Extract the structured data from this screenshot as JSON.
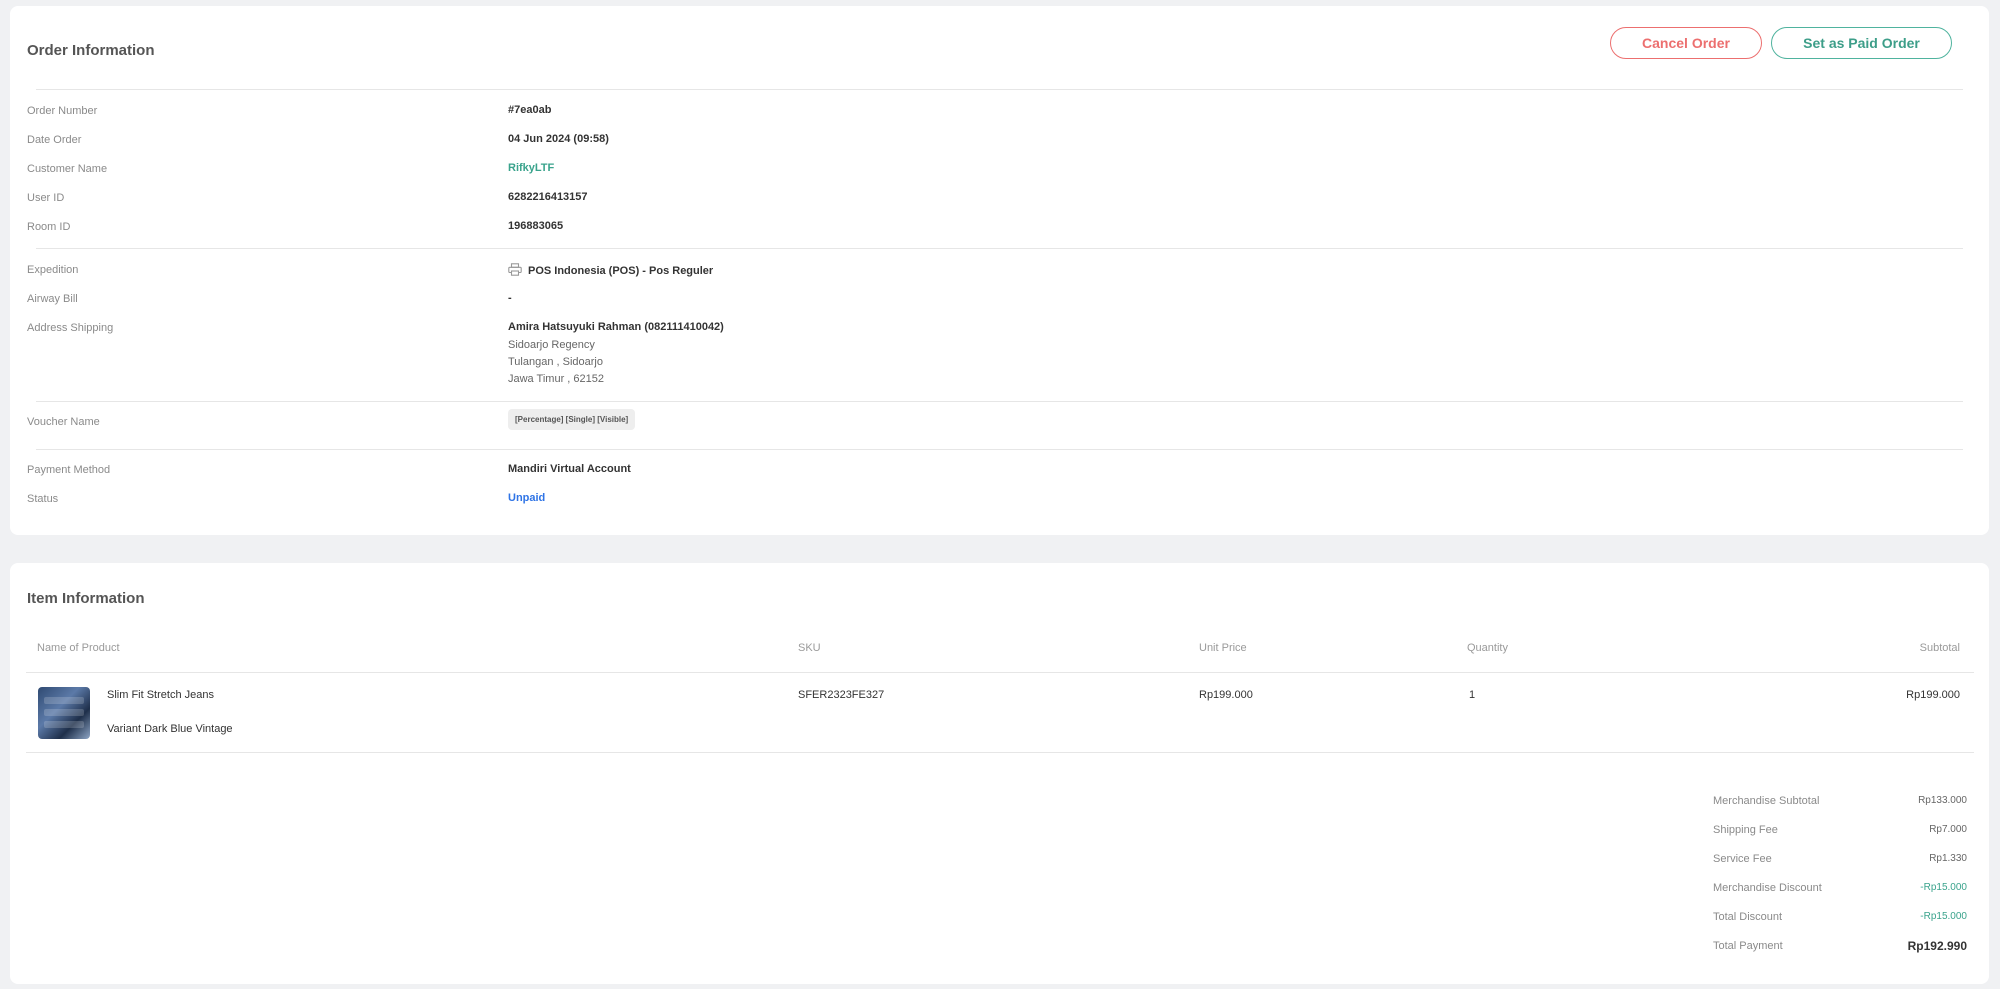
{
  "order_info": {
    "title": "Order Information",
    "cancel_label": "Cancel Order",
    "paid_label": "Set as Paid Order",
    "fields": {
      "order_number": {
        "label": "Order Number",
        "value": "#7ea0ab"
      },
      "date_order": {
        "label": "Date Order",
        "value": "04 Jun 2024 (09:58)"
      },
      "customer_name": {
        "label": "Customer Name",
        "value": "RifkyLTF"
      },
      "user_id": {
        "label": "User ID",
        "value": "6282216413157"
      },
      "room_id": {
        "label": "Room ID",
        "value": "196883065"
      },
      "expedition": {
        "label": "Expedition",
        "value": "POS Indonesia (POS) - Pos Reguler",
        "icon": "printer-icon"
      },
      "airway_bill": {
        "label": "Airway Bill",
        "value": "-"
      },
      "address_shipping": {
        "label": "Address Shipping",
        "name_line": "Amira Hatsuyuki Rahman (082111410042)",
        "line2": "Sidoarjo Regency",
        "line3": "Tulangan , Sidoarjo",
        "line4": "Jawa Timur , 62152"
      },
      "voucher_name": {
        "label": "Voucher Name",
        "chip": "[Percentage] [Single] [Visible]"
      },
      "payment_method": {
        "label": "Payment Method",
        "value": "Mandiri Virtual Account"
      },
      "status": {
        "label": "Status",
        "value": "Unpaid"
      }
    }
  },
  "item_info": {
    "title": "Item Information",
    "columns": {
      "product": "Name of Product",
      "sku": "SKU",
      "unit_price": "Unit Price",
      "quantity": "Quantity",
      "subtotal": "Subtotal"
    },
    "rows": [
      {
        "name": "Slim Fit Stretch Jeans",
        "variant": "Variant Dark Blue Vintage",
        "sku": "SFER2323FE327",
        "unit_price": "Rp199.000",
        "quantity": "1",
        "subtotal": "Rp199.000"
      }
    ],
    "summary": {
      "merchandise_subtotal": {
        "label": "Merchandise Subtotal",
        "value": "Rp133.000"
      },
      "shipping_fee": {
        "label": "Shipping Fee",
        "value": "Rp7.000"
      },
      "service_fee": {
        "label": "Service Fee",
        "value": "Rp1.330"
      },
      "merchandise_discount": {
        "label": "Merchandise Discount",
        "value": "-Rp15.000"
      },
      "total_discount": {
        "label": "Total Discount",
        "value": "-Rp15.000"
      },
      "total_payment": {
        "label": "Total Payment",
        "value": "Rp192.990"
      }
    }
  },
  "colors": {
    "cancel": "#ec6f6f",
    "paid": "#4fb39e",
    "link_green": "#3aa38c",
    "status_blue": "#2f74e6"
  }
}
